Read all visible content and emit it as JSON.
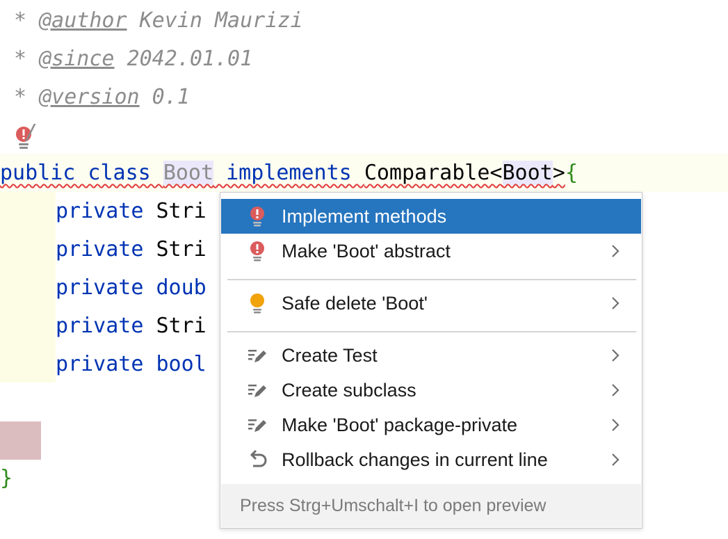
{
  "editor": {
    "doc_lines": [
      {
        "star": "* ",
        "tag": "@author",
        "value": " Kevin Maurizi"
      },
      {
        "star": "* ",
        "tag": "@since",
        "value": " 2042.01.01"
      },
      {
        "star": "* ",
        "tag": "@version",
        "value": " 0.1"
      }
    ],
    "doc_end": "/",
    "class_line": {
      "kw1": "public class ",
      "name": "Boot",
      "kw2": " implements ",
      "iface": "Comparable<",
      "generic": "Boot",
      "close": ">",
      "brace": "{"
    },
    "fields": [
      {
        "kw": "private ",
        "type": "Stri"
      },
      {
        "kw": "private ",
        "type": "Stri"
      },
      {
        "kw": "private ",
        "type": "doub"
      },
      {
        "kw": "private ",
        "type": "Stri"
      },
      {
        "kw": "private ",
        "type": "bool"
      }
    ],
    "closing_brace": "}"
  },
  "popup": {
    "items": [
      {
        "label": "Implement methods",
        "icon": "error-bulb-icon",
        "submenu": false,
        "selected": true
      },
      {
        "label": "Make 'Boot' abstract",
        "icon": "error-bulb-icon",
        "submenu": true,
        "selected": false
      },
      {
        "label": "Safe delete 'Boot'",
        "icon": "intention-bulb-icon",
        "submenu": true,
        "selected": false
      },
      {
        "label": "Create Test",
        "icon": "edit-pencil-icon",
        "submenu": true,
        "selected": false
      },
      {
        "label": "Create subclass",
        "icon": "edit-pencil-icon",
        "submenu": true,
        "selected": false
      },
      {
        "label": "Make 'Boot' package-private",
        "icon": "edit-pencil-icon",
        "submenu": true,
        "selected": false
      },
      {
        "label": "Rollback changes in current line",
        "icon": "undo-arrow-icon",
        "submenu": true,
        "selected": false
      }
    ],
    "footer": "Press Strg+Umschalt+I to open preview"
  },
  "colors": {
    "keyword": "#0033b3",
    "doc_comment": "#8c8c8c",
    "selection": "#2675bf",
    "error_red": "#db5c5c",
    "warning_amber": "#f0a30a",
    "brace_green": "#2f8a1a"
  }
}
